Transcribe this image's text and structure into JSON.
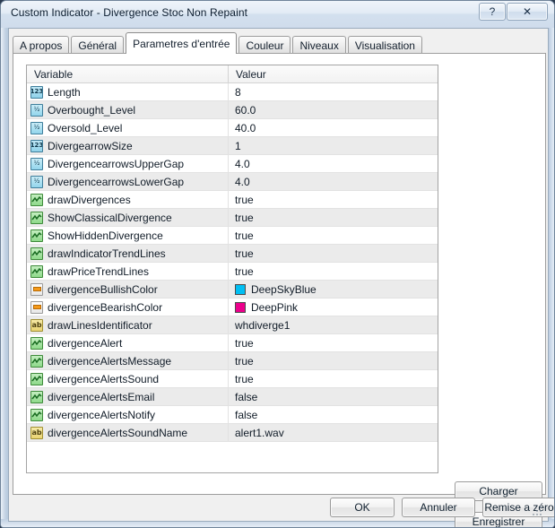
{
  "window": {
    "title": "Custom Indicator - Divergence Stoc Non Repaint",
    "help_button": "?",
    "close_button": "✕"
  },
  "tabs": [
    {
      "label": "A propos",
      "active": false
    },
    {
      "label": "Général",
      "active": false
    },
    {
      "label": "Parametres d'entrée",
      "active": true
    },
    {
      "label": "Couleur",
      "active": false
    },
    {
      "label": "Niveaux",
      "active": false
    },
    {
      "label": "Visualisation",
      "active": false
    }
  ],
  "grid": {
    "columns": {
      "variable": "Variable",
      "valeur": "Valeur"
    },
    "rows": [
      {
        "icon": "int-type-icon",
        "type": "int",
        "name": "Length",
        "value": "8"
      },
      {
        "icon": "double-type-icon",
        "type": "double",
        "name": "Overbought_Level",
        "value": "60.0"
      },
      {
        "icon": "double-type-icon",
        "type": "double",
        "name": "Oversold_Level",
        "value": "40.0"
      },
      {
        "icon": "int-type-icon",
        "type": "int",
        "name": "DivergearrowSize",
        "value": "1"
      },
      {
        "icon": "double-type-icon",
        "type": "double",
        "name": "DivergencearrowsUpperGap",
        "value": "4.0"
      },
      {
        "icon": "double-type-icon",
        "type": "double",
        "name": "DivergencearrowsLowerGap",
        "value": "4.0"
      },
      {
        "icon": "bool-type-icon",
        "type": "bool",
        "name": "drawDivergences",
        "value": "true"
      },
      {
        "icon": "bool-type-icon",
        "type": "bool",
        "name": "ShowClassicalDivergence",
        "value": "true"
      },
      {
        "icon": "bool-type-icon",
        "type": "bool",
        "name": "ShowHiddenDivergence",
        "value": "true"
      },
      {
        "icon": "bool-type-icon",
        "type": "bool",
        "name": "drawIndicatorTrendLines",
        "value": "true"
      },
      {
        "icon": "bool-type-icon",
        "type": "bool",
        "name": "drawPriceTrendLines",
        "value": "true"
      },
      {
        "icon": "color-type-icon",
        "type": "color",
        "name": "divergenceBullishColor",
        "value": "DeepSkyBlue",
        "swatch": "#00BFF3"
      },
      {
        "icon": "color-type-icon",
        "type": "color",
        "name": "divergenceBearishColor",
        "value": "DeepPink",
        "swatch": "#EC008C"
      },
      {
        "icon": "string-type-icon",
        "type": "string",
        "name": "drawLinesIdentificator",
        "value": "whdiverge1"
      },
      {
        "icon": "bool-type-icon",
        "type": "bool",
        "name": "divergenceAlert",
        "value": "true"
      },
      {
        "icon": "bool-type-icon",
        "type": "bool",
        "name": "divergenceAlertsMessage",
        "value": "true"
      },
      {
        "icon": "bool-type-icon",
        "type": "bool",
        "name": "divergenceAlertsSound",
        "value": "true"
      },
      {
        "icon": "bool-type-icon",
        "type": "bool",
        "name": "divergenceAlertsEmail",
        "value": "false"
      },
      {
        "icon": "bool-type-icon",
        "type": "bool",
        "name": "divergenceAlertsNotify",
        "value": "false"
      },
      {
        "icon": "string-type-icon",
        "type": "string",
        "name": "divergenceAlertsSoundName",
        "value": "alert1.wav"
      }
    ]
  },
  "side_buttons": {
    "load": "Charger",
    "save": "Enregistrer"
  },
  "footer_buttons": {
    "ok": "OK",
    "cancel": "Annuler",
    "reset": "Remise a zéro"
  },
  "icon_labels": {
    "int": "123",
    "double": "½",
    "string": "ab"
  }
}
